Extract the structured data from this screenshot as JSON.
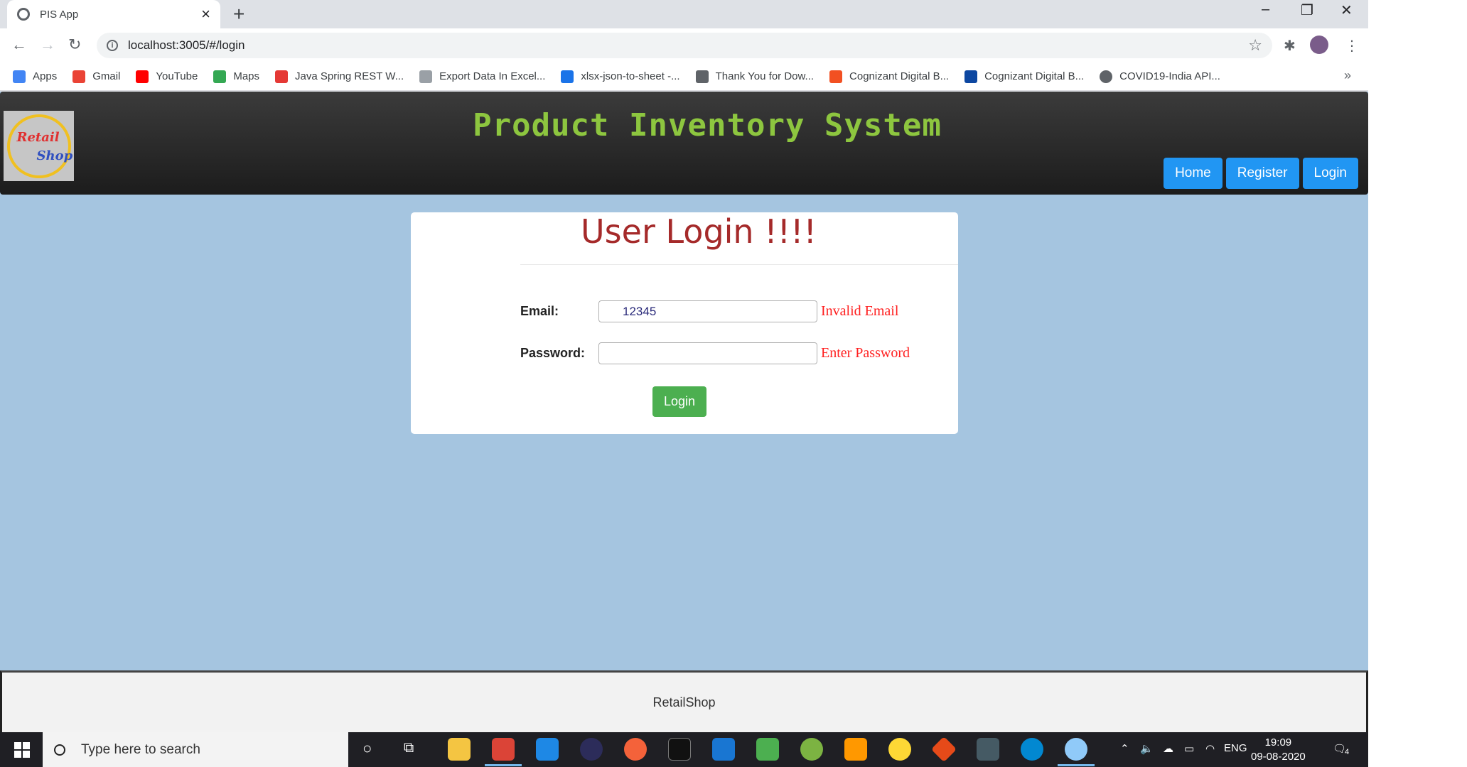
{
  "browser": {
    "tab_title": "PIS App",
    "url": "localhost:3005/#/login",
    "bookmarks": [
      {
        "label": "Apps",
        "color": "#4285f4"
      },
      {
        "label": "Gmail",
        "color": "#ea4335"
      },
      {
        "label": "YouTube",
        "color": "#ff0000"
      },
      {
        "label": "Maps",
        "color": "#34a853"
      },
      {
        "label": "Java Spring REST W...",
        "color": "#e53935"
      },
      {
        "label": "Export Data In Excel...",
        "color": "#9aa0a6"
      },
      {
        "label": "xlsx-json-to-sheet -...",
        "color": "#1a73e8"
      },
      {
        "label": "Thank You for Dow...",
        "color": "#5f6368"
      },
      {
        "label": "Cognizant Digital B...",
        "color": "#f25022"
      },
      {
        "label": "Cognizant Digital B...",
        "color": "#0d47a1"
      },
      {
        "label": "COVID19-India API...",
        "color": "#5f6368"
      }
    ],
    "more_bookmarks": "»"
  },
  "header": {
    "logo_line1": "Retail",
    "logo_line2": "Shop",
    "title": "Product Inventory System",
    "nav": [
      "Home",
      "Register",
      "Login"
    ]
  },
  "login": {
    "heading": "User Login !!!!",
    "email_label": "Email:",
    "email_value": "12345",
    "email_error": "Invalid Email",
    "password_label": "Password:",
    "password_value": "",
    "password_error": "Enter Password",
    "submit_label": "Login"
  },
  "footer": {
    "text": "RetailShop"
  },
  "taskbar": {
    "search_placeholder": "Type here to search",
    "lang": "ENG",
    "time": "19:09",
    "date": "09-08-2020",
    "notifications": "4"
  },
  "colors": {
    "page_bg": "#a5c5e0",
    "title_green": "#8dc63f",
    "nav_blue": "#2196f3",
    "heading_red": "#a52a2a",
    "error_red": "#ff2020",
    "login_green": "#4caf50"
  }
}
